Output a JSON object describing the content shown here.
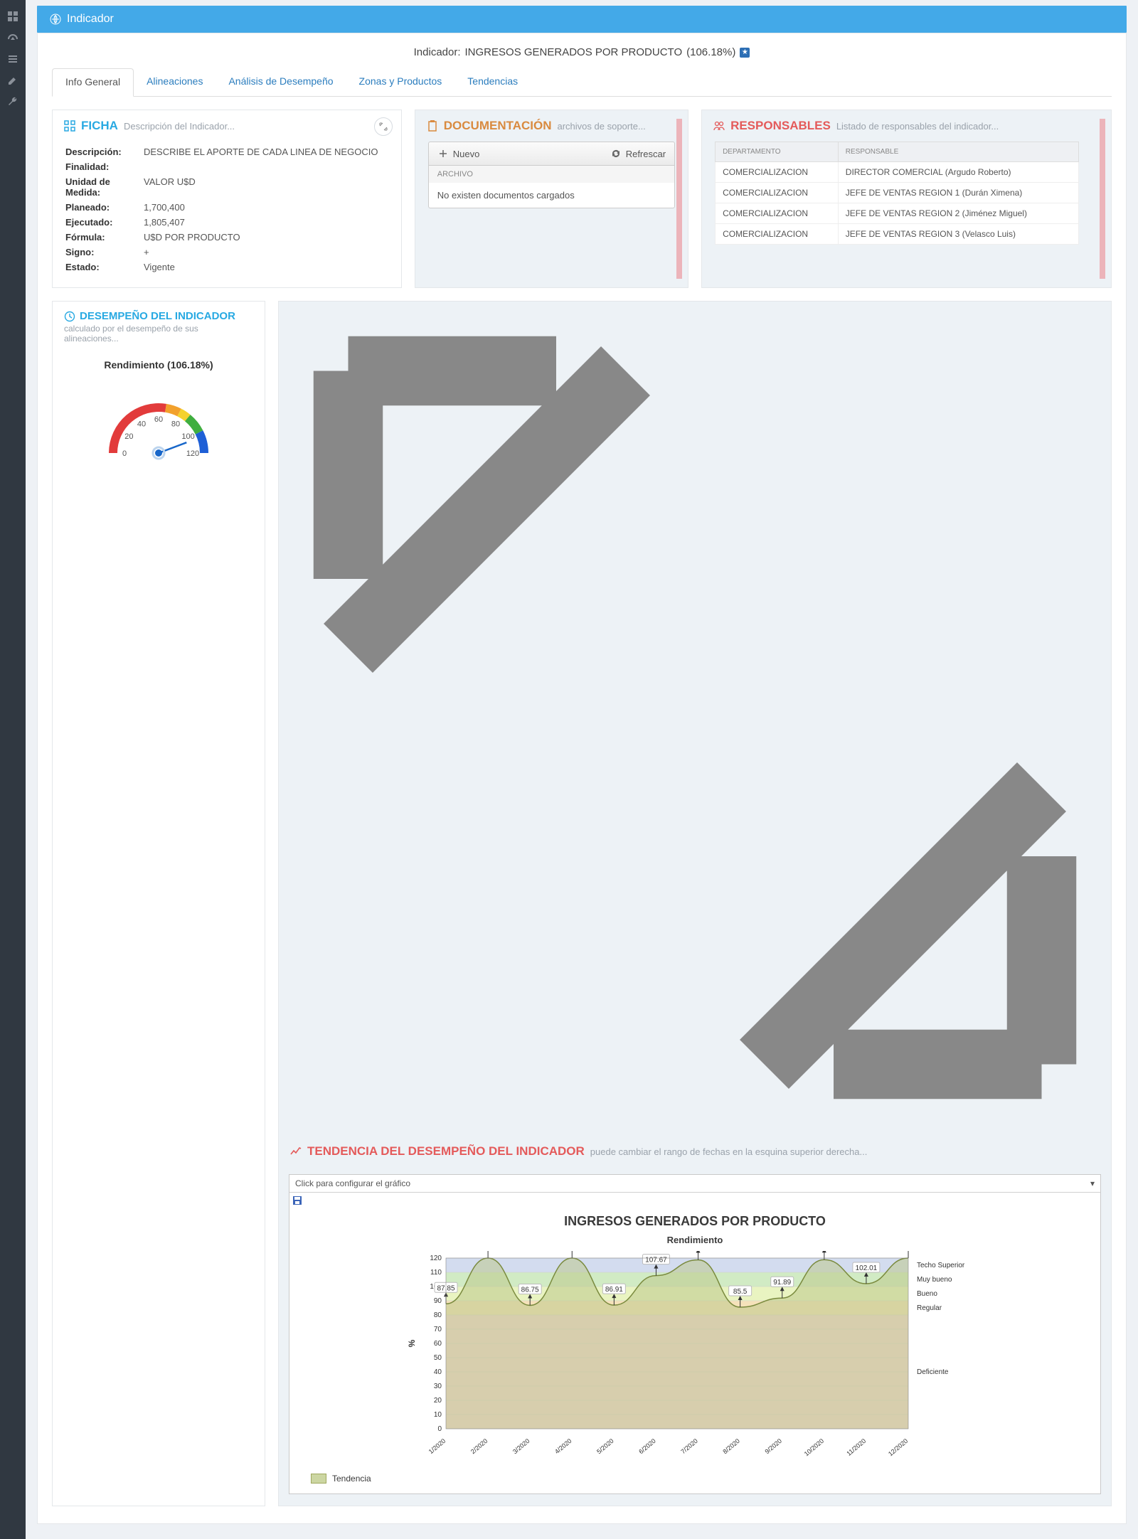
{
  "titlebar": {
    "title": "Indicador"
  },
  "header": {
    "prefix": "Indicador:",
    "name": "INGRESOS GENERADOS POR PRODUCTO",
    "pct": "(106.18%)"
  },
  "tabs": {
    "info": "Info General",
    "alineaciones": "Alineaciones",
    "analisis": "Análisis de Desempeño",
    "zonas": "Zonas y Productos",
    "tendencias": "Tendencias"
  },
  "ficha": {
    "title": "FICHA",
    "subtitle": "Descripción del Indicador...",
    "labels": {
      "descripcion": "Descripción:",
      "finalidad": "Finalidad:",
      "unidad": "Unidad de Medida:",
      "planeado": "Planeado:",
      "ejecutado": "Ejecutado:",
      "formula": "Fórmula:",
      "signo": "Signo:",
      "estado": "Estado:"
    },
    "values": {
      "descripcion": "DESCRIBE EL APORTE DE CADA LINEA DE NEGOCIO",
      "finalidad": "",
      "unidad": "VALOR U$D",
      "planeado": "1,700,400",
      "ejecutado": "1,805,407",
      "formula": "U$D POR PRODUCTO",
      "signo": "+",
      "estado": "Vigente"
    }
  },
  "documentacion": {
    "title": "DOCUMENTACIÓN",
    "subtitle": "archivos de soporte...",
    "nuevo": "Nuevo",
    "refrescar": "Refrescar",
    "col": "ARCHIVO",
    "empty": "No existen documentos cargados"
  },
  "responsables": {
    "title": "RESPONSABLES",
    "subtitle": "Listado de responsables del indicador...",
    "cols": {
      "dept": "DEPARTAMENTO",
      "resp": "RESPONSABLE"
    },
    "rows": [
      {
        "dept": "COMERCIALIZACION",
        "resp": "DIRECTOR COMERCIAL (Argudo Roberto)"
      },
      {
        "dept": "COMERCIALIZACION",
        "resp": "JEFE DE VENTAS REGION 1 (Durán Ximena)"
      },
      {
        "dept": "COMERCIALIZACION",
        "resp": "JEFE DE VENTAS REGION 2 (Jiménez Miguel)"
      },
      {
        "dept": "COMERCIALIZACION",
        "resp": "JEFE DE VENTAS REGION 3 (Velasco Luis)"
      }
    ]
  },
  "gauge": {
    "title": "DESEMPEÑO DEL INDICADOR",
    "subtitle": "calculado por el desempeño de sus alineaciones...",
    "label": "Rendimiento (106.18%)",
    "ticks": [
      "0",
      "20",
      "40",
      "60",
      "80",
      "100",
      "120"
    ],
    "value_pct_of_scale": 0.885
  },
  "trend": {
    "title": "TENDENCIA DEL DESEMPEÑO DEL INDICADOR",
    "subtitle": "puede cambiar el rango de fechas en la esquina superior derecha...",
    "configure": "Click para configurar el gráfico",
    "chart_title": "INGRESOS GENERADOS POR PRODUCTO",
    "chart_sub": "Rendimiento",
    "legend": "Tendencia",
    "ylabel": "%",
    "bands": {
      "techo": "Techo Superior",
      "muybueno": "Muy bueno",
      "bueno": "Bueno",
      "regular": "Regular",
      "deficiente": "Deficiente"
    }
  },
  "chart_data": {
    "type": "line",
    "categories": [
      "1/2020",
      "2/2020",
      "3/2020",
      "4/2020",
      "5/2020",
      "6/2020",
      "7/2020",
      "8/2020",
      "9/2020",
      "10/2020",
      "11/2020",
      "12/2020"
    ],
    "series": [
      {
        "name": "Tendencia",
        "values": [
          87.85,
          120,
          86.75,
          120,
          86.91,
          107.67,
          118.72,
          85.5,
          91.89,
          118.86,
          102.01,
          120
        ]
      }
    ],
    "bands": [
      {
        "name": "Techo Superior",
        "from": 110,
        "to": 120,
        "color": "#bcc9e6"
      },
      {
        "name": "Muy bueno",
        "from": 100,
        "to": 110,
        "color": "#b9e0a4"
      },
      {
        "name": "Bueno",
        "from": 90,
        "to": 100,
        "color": "#ddeea0"
      },
      {
        "name": "Regular",
        "from": 80,
        "to": 90,
        "color": "#f0d295"
      },
      {
        "name": "Deficiente",
        "from": 0,
        "to": 80,
        "color": "#f2bdbd"
      }
    ],
    "title": "INGRESOS GENERADOS POR PRODUCTO",
    "xlabel": "",
    "ylabel": "%",
    "ylim": [
      0,
      120
    ]
  }
}
